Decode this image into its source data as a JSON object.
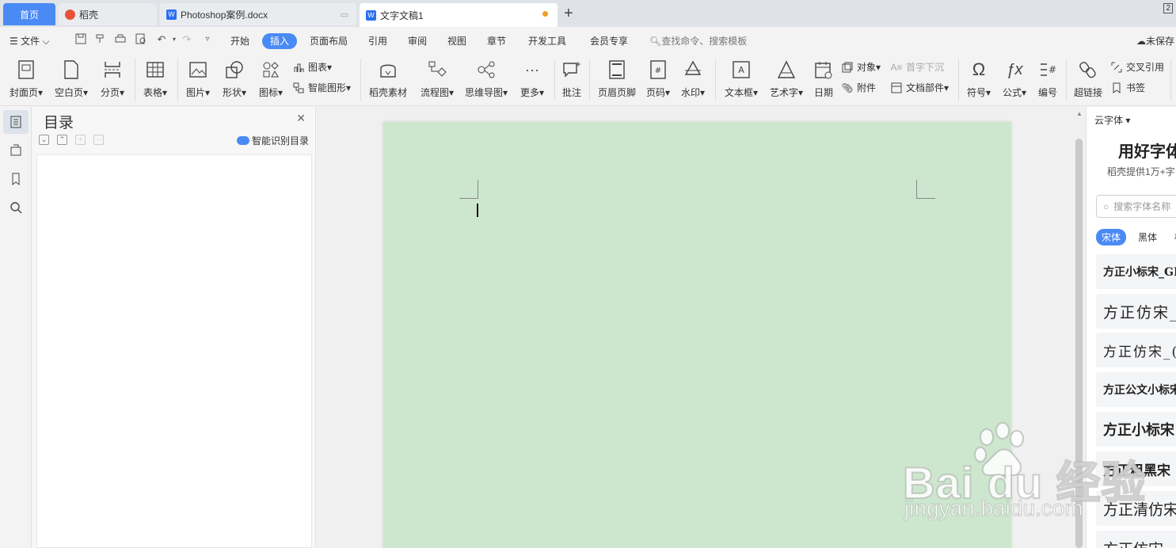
{
  "tabs": [
    {
      "label": "首页"
    },
    {
      "label": "稻壳"
    },
    {
      "label": "Photoshop案例.docx"
    },
    {
      "label": "文字文稿1"
    }
  ],
  "window_badge": "2",
  "menu": {
    "file": "文件",
    "items": [
      "开始",
      "插入",
      "页面布局",
      "引用",
      "审阅",
      "视图",
      "章节",
      "开发工具",
      "会员专享"
    ],
    "active": "插入",
    "search_placeholder": "查找命令、搜索模板",
    "save_status": "未保存"
  },
  "ribbon": {
    "cover": "封面页",
    "blank": "空白页",
    "pagebreak": "分页",
    "table": "表格",
    "picture": "图片",
    "shape": "形状",
    "icon": "图标",
    "chart": "图表",
    "smart_graphic": "智能图形",
    "daoke_material": "稻壳素材",
    "flowchart": "流程图",
    "mindmap": "思维导图",
    "more": "更多",
    "comment": "批注",
    "header_footer": "页眉页脚",
    "page_number": "页码",
    "watermark": "水印",
    "textbox": "文本框",
    "wordart": "艺术字",
    "date": "日期",
    "object": "对象",
    "attachment": "附件",
    "dropcap": "首字下沉",
    "doc_parts": "文档部件",
    "symbol": "符号",
    "formula": "公式",
    "numbering": "编号",
    "hyperlink": "超链接",
    "cross_ref": "交叉引用",
    "bookmark": "书签"
  },
  "outline": {
    "title": "目录",
    "smart_toc": "智能识别目录"
  },
  "font_panel": {
    "header": "云字体",
    "title": "用好字体",
    "subtitle": "稻壳提供1万+字",
    "search_placeholder": "搜索字体名称",
    "tabs": [
      "宋体",
      "黑体",
      "楷"
    ],
    "fonts": [
      "方正小标宋_GB",
      "方正仿宋_",
      "方正仿宋_(",
      "方正公文小标宋",
      "方正小标宋",
      "方正粗黑宋",
      "方正清仿宋",
      "方正仿宋"
    ]
  },
  "watermark": {
    "logo": "Bai  du 经验",
    "url": "jingyan.baidu.com"
  },
  "colors": {
    "accent": "#4a8af4",
    "page": "#cde6ce",
    "unsaved_dot": "#f0a020"
  }
}
